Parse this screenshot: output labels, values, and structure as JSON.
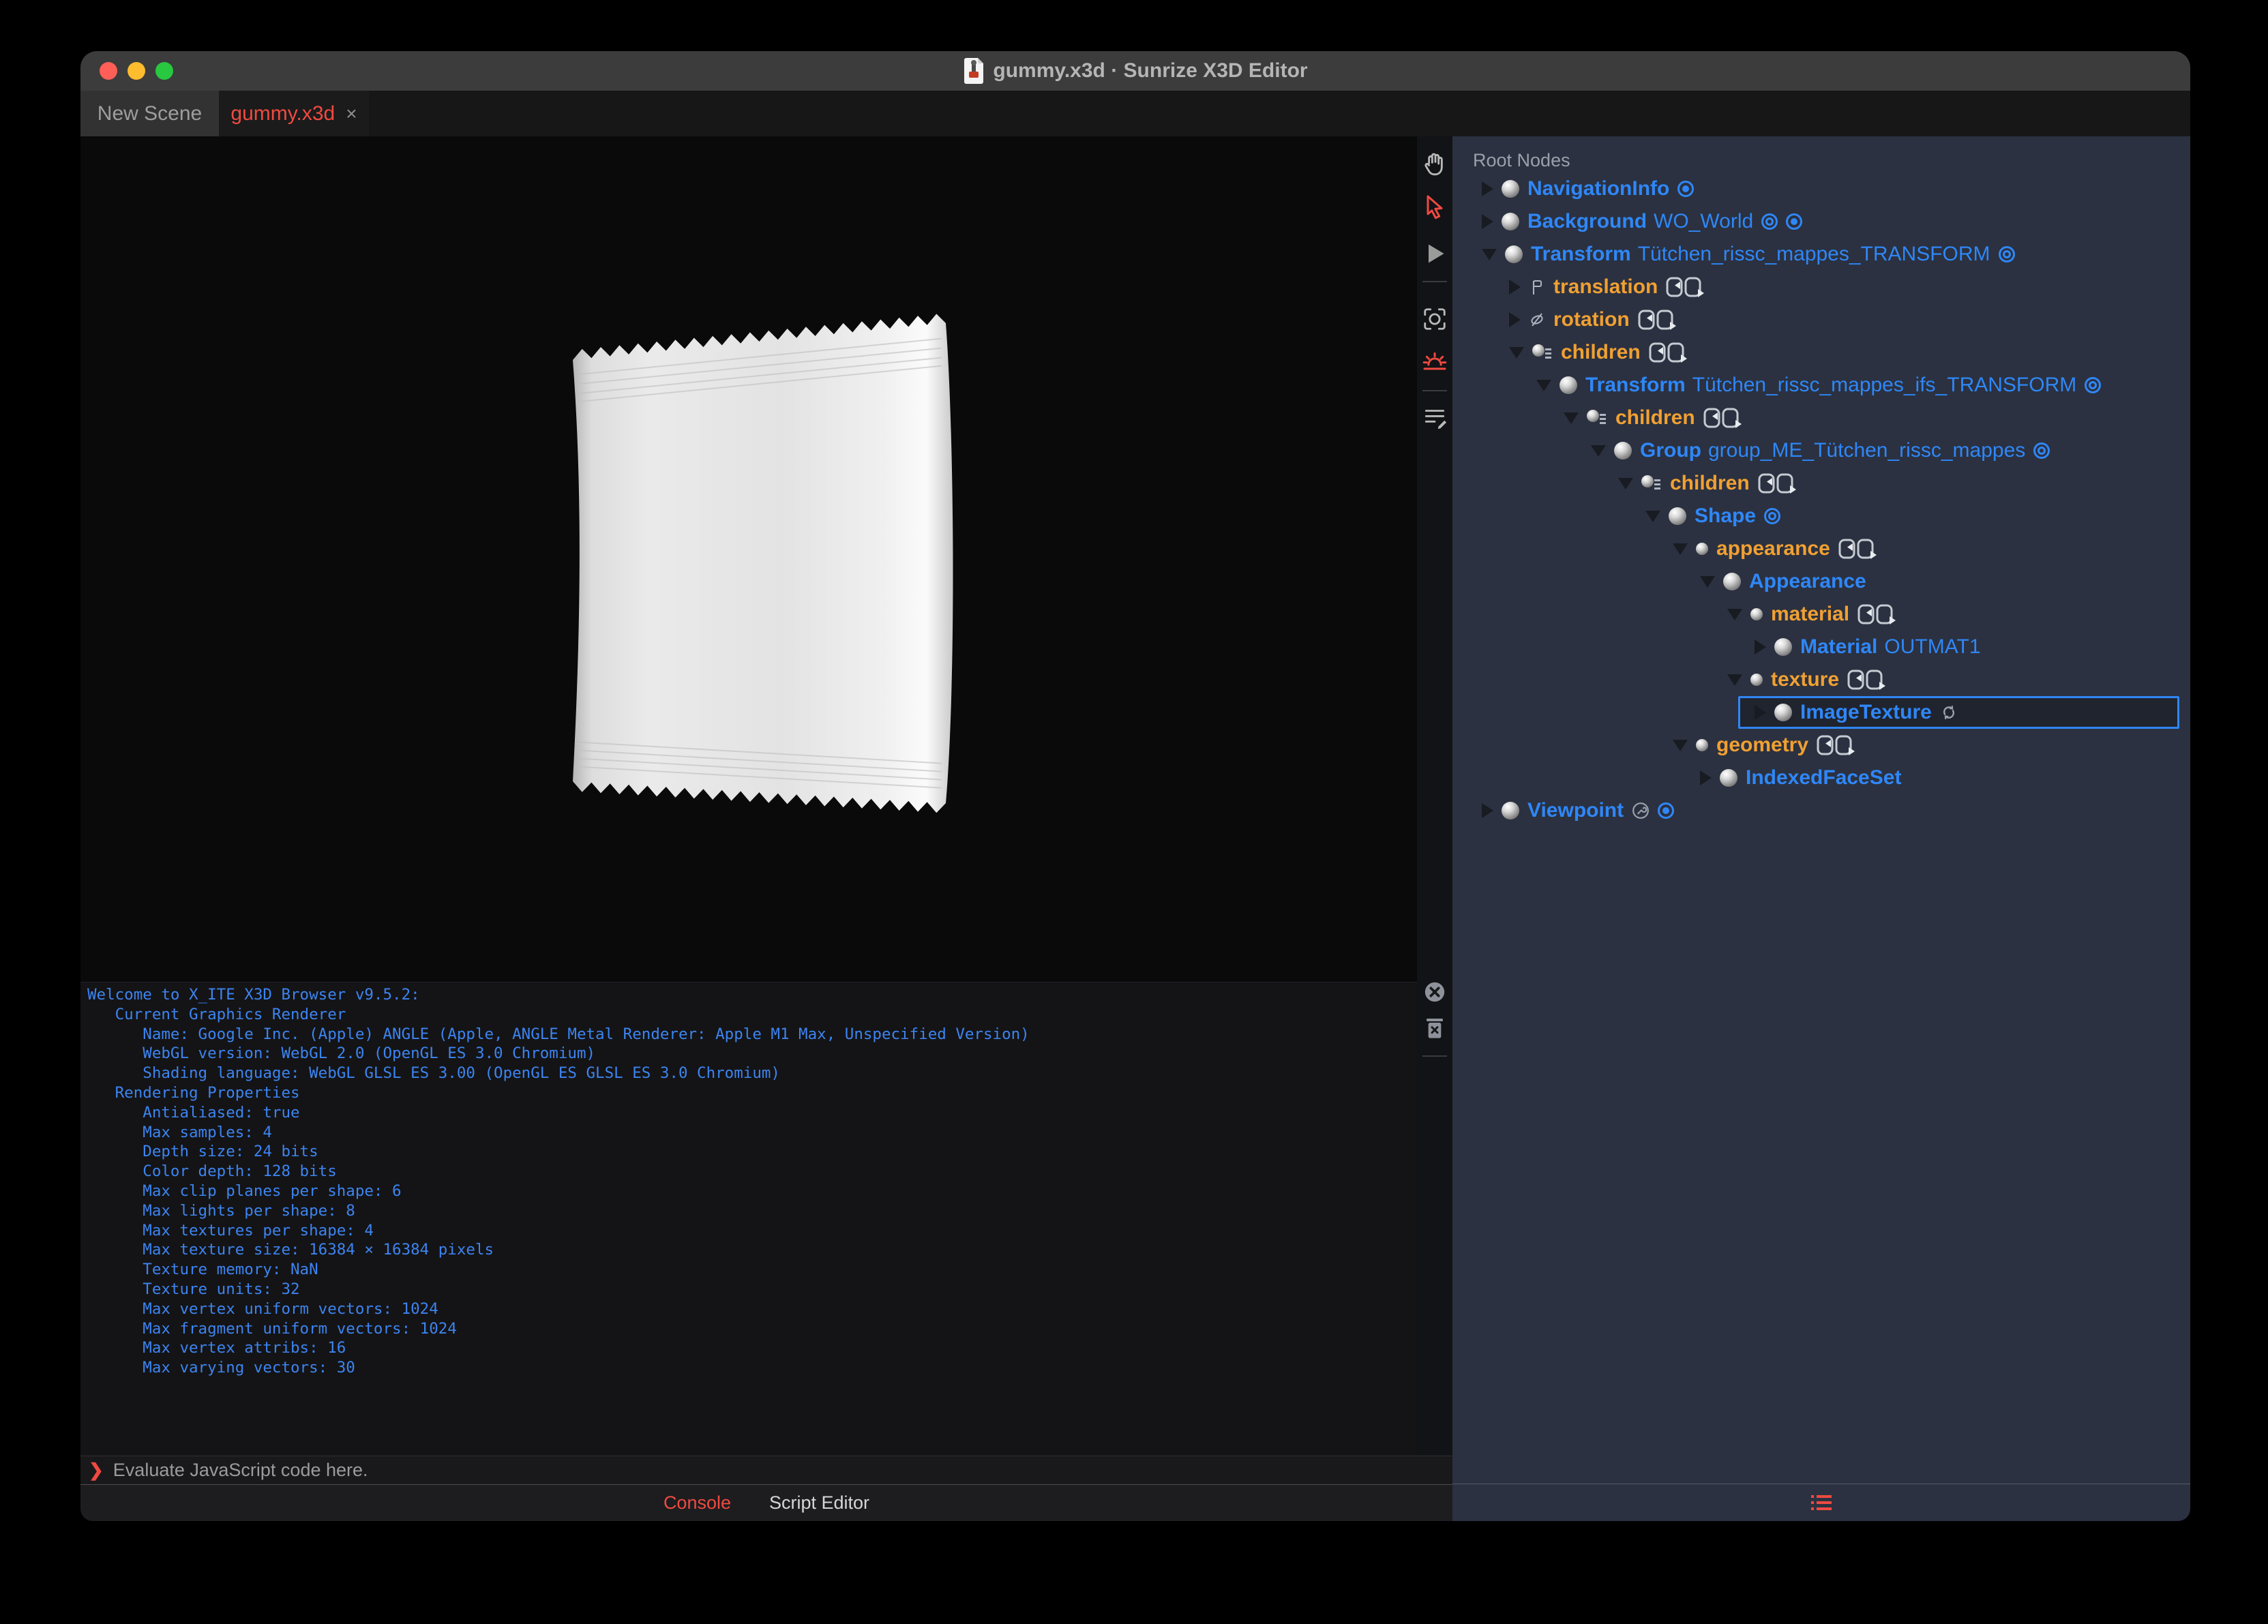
{
  "window": {
    "title": "gummy.x3d · Sunrize X3D Editor",
    "traffic_lights": [
      "close-red",
      "minimize-yellow",
      "zoom-green"
    ],
    "traffic_colors": {
      "red": "#ff5f57",
      "yellow": "#febc2e",
      "green": "#28c840"
    }
  },
  "tabs": [
    {
      "label": "New Scene",
      "active": false
    },
    {
      "label": "gummy.x3d",
      "active": true,
      "close": "×"
    }
  ],
  "viewport": {
    "content": "white flow-wrap pouch render on black"
  },
  "toolbar": {
    "viewport_tools": [
      "pan-hand",
      "select-arrow (active red)",
      "play",
      "screenshot-viewfinder",
      "sunrise-light (active red)",
      "scene-notes-pencil"
    ],
    "console_tools": [
      "clear-console",
      "delete-trash"
    ]
  },
  "console": {
    "output": "Welcome to X_ITE X3D Browser v9.5.2:\n   Current Graphics Renderer\n      Name: Google Inc. (Apple) ANGLE (Apple, ANGLE Metal Renderer: Apple M1 Max, Unspecified Version)\n      WebGL version: WebGL 2.0 (OpenGL ES 3.0 Chromium)\n      Shading language: WebGL GLSL ES 3.00 (OpenGL ES GLSL ES 3.0 Chromium)\n   Rendering Properties\n      Antialiased: true\n      Max samples: 4\n      Depth size: 24 bits\n      Color depth: 128 bits\n      Max clip planes per shape: 6\n      Max lights per shape: 8\n      Max textures per shape: 4\n      Max texture size: 16384 × 16384 pixels\n      Texture memory: NaN\n      Texture units: 32\n      Max vertex uniform vectors: 1024\n      Max fragment uniform vectors: 1024\n      Max vertex attribs: 16\n      Max varying vectors: 30",
    "prompt_symbol": "❯",
    "prompt_placeholder": "Evaluate JavaScript code here.",
    "tabs": [
      {
        "label": "Console",
        "active": true
      },
      {
        "label": "Script Editor",
        "active": false
      }
    ]
  },
  "outline": {
    "header": "Root Nodes",
    "rows": [
      {
        "name": "NavigationInfo",
        "def": "",
        "kind": "node"
      },
      {
        "name": "Background",
        "def": "WO_World",
        "kind": "node"
      },
      {
        "name": "Transform",
        "def": "Tütchen_rissc_mappes_TRANSFORM",
        "kind": "node"
      },
      {
        "name": "translation",
        "def": "",
        "kind": "field"
      },
      {
        "name": "rotation",
        "def": "",
        "kind": "field"
      },
      {
        "name": "children",
        "def": "",
        "kind": "field"
      },
      {
        "name": "Transform",
        "def": "Tütchen_rissc_mappes_ifs_TRANSFORM",
        "kind": "node"
      },
      {
        "name": "children",
        "def": "",
        "kind": "field"
      },
      {
        "name": "Group",
        "def": "group_ME_Tütchen_rissc_mappes",
        "kind": "node"
      },
      {
        "name": "children",
        "def": "",
        "kind": "field"
      },
      {
        "name": "Shape",
        "def": "",
        "kind": "node"
      },
      {
        "name": "appearance",
        "def": "",
        "kind": "field"
      },
      {
        "name": "Appearance",
        "def": "",
        "kind": "node"
      },
      {
        "name": "material",
        "def": "",
        "kind": "field"
      },
      {
        "name": "Material",
        "def": "OUTMAT1",
        "kind": "node"
      },
      {
        "name": "texture",
        "def": "",
        "kind": "field"
      },
      {
        "name": "ImageTexture",
        "def": "",
        "kind": "node",
        "selected": true
      },
      {
        "name": "geometry",
        "def": "",
        "kind": "field"
      },
      {
        "name": "IndexedFaceSet",
        "def": "",
        "kind": "node"
      },
      {
        "name": "Viewpoint",
        "def": "",
        "kind": "node"
      }
    ]
  },
  "colors": {
    "accent_blue": "#2f87f7",
    "field_orange": "#f0a033",
    "accent_red": "#ef4a41",
    "panel_bg": "#2b3140"
  }
}
